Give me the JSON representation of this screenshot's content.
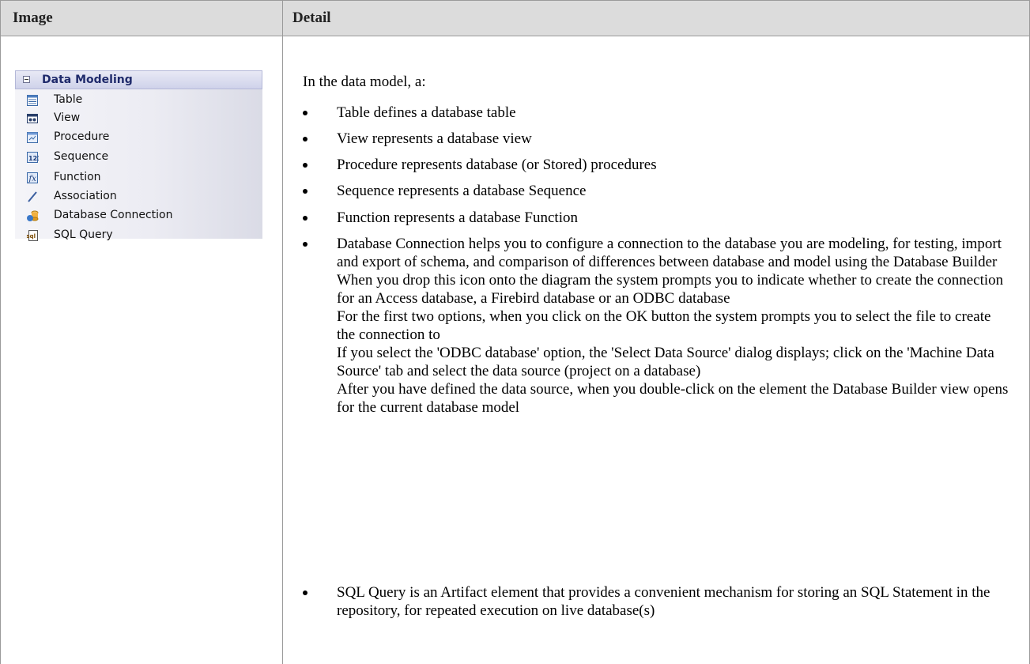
{
  "header": {
    "col1": "Image",
    "col2": "Detail"
  },
  "palette": {
    "title": "Data Modeling",
    "items": [
      {
        "label": "Table",
        "icon": "table-icon"
      },
      {
        "label": "View",
        "icon": "view-icon"
      },
      {
        "label": "Procedure",
        "icon": "procedure-icon"
      },
      {
        "label": "Sequence",
        "icon": "sequence-icon"
      },
      {
        "label": "Function",
        "icon": "function-icon"
      },
      {
        "label": "Association",
        "icon": "association-icon"
      },
      {
        "label": "Database Connection",
        "icon": "database-connection-icon"
      },
      {
        "label": "SQL Query",
        "icon": "sql-query-icon"
      }
    ]
  },
  "detail": {
    "intro": "In the data model, a:",
    "bullets": [
      {
        "paras": [
          "Table defines a database table"
        ]
      },
      {
        "paras": [
          "View represents a database view"
        ]
      },
      {
        "paras": [
          "Procedure represents database (or Stored) procedures"
        ]
      },
      {
        "paras": [
          "Sequence represents a database Sequence"
        ]
      },
      {
        "paras": [
          "Function represents a database Function"
        ]
      },
      {
        "paras": [
          "Database Connection helps you to configure a connection to the database you are modeling, for testing, import and export of schema, and comparison of differences between database and model using the Database Builder",
          "When you drop this icon onto the diagram the system prompts you to indicate whether to create the connection for an Access database, a Firebird database or an ODBC database",
          "For the first two options, when you click on the OK button the system prompts you to select the file to create the connection to",
          "If you select the 'ODBC database' option, the 'Select Data Source' dialog displays; click on the 'Machine Data Source' tab and select the data source (project on a database)",
          "After you have defined the data source, when you double-click on the element the Database Builder view opens for the current database model"
        ]
      },
      {
        "paras": [
          "SQL Query is an Artifact element that provides a convenient mechanism for storing an SQL Statement in the repository, for repeated execution on live database(s)"
        ]
      }
    ]
  }
}
